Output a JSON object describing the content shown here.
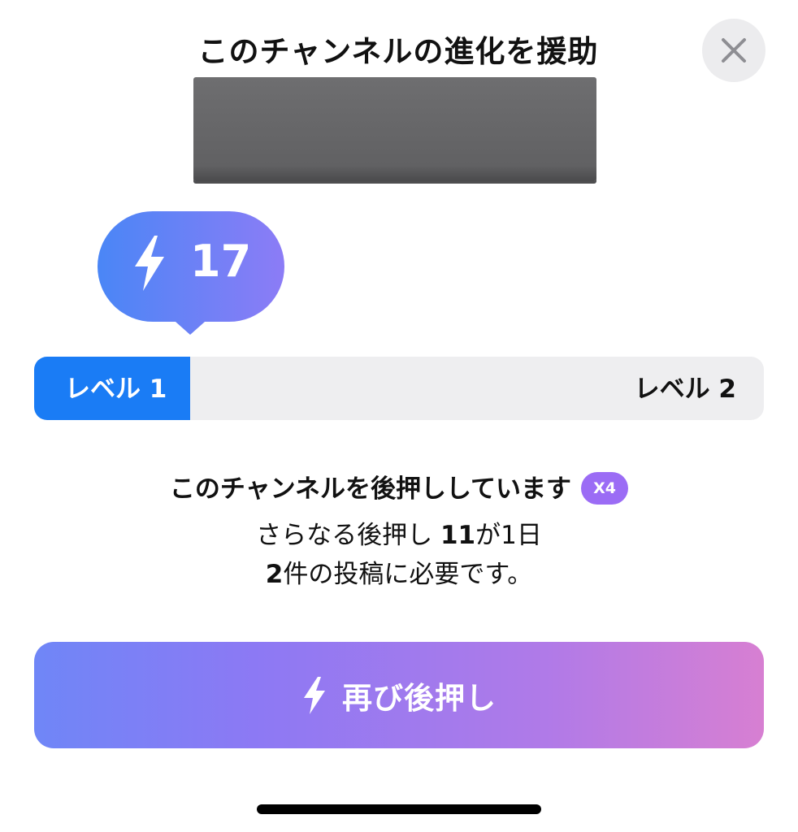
{
  "header": {
    "title": "このチャンネルの進化を援助",
    "close_icon": "close-icon"
  },
  "boost": {
    "icon": "bolt-icon",
    "count": "17"
  },
  "progress": {
    "current_level": "レベル 1",
    "next_level": "レベル 2",
    "fraction": 0.214,
    "fill_color": "#1a7cf5"
  },
  "status": {
    "line1": "このチャンネルを後押ししています",
    "multiplier": "X4",
    "line2_prefix": "さらなる後押し ",
    "line2_count": "11",
    "line2_suffix": "が1日",
    "line3_count": "2",
    "line3_suffix": "件の投稿に必要です。"
  },
  "action": {
    "label": "再び後押し",
    "icon": "bolt-icon"
  },
  "colors": {
    "accent_blue": "#1a7cf5",
    "badge_purple": "#9b6cf5",
    "button_gradient_start": "#6f86f7",
    "button_gradient_end": "#d77fd2"
  }
}
